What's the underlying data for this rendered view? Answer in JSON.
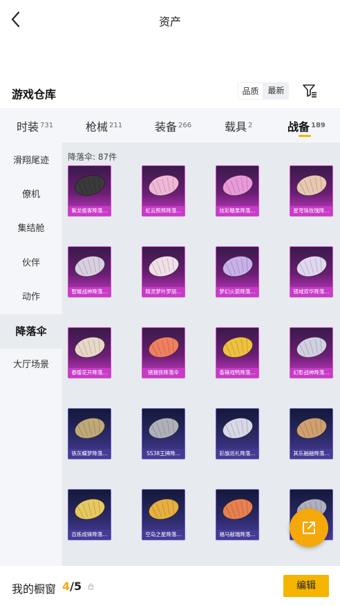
{
  "header": {
    "title": "资产",
    "back_icon": "chevron-left-icon"
  },
  "warehouse": {
    "title": "游戏仓库",
    "sort_options": [
      "品质",
      "最新"
    ],
    "filter_icon": "filter-icon"
  },
  "tabs": [
    {
      "label": "时装",
      "count": "731"
    },
    {
      "label": "枪械",
      "count": "211"
    },
    {
      "label": "装备",
      "count": "266"
    },
    {
      "label": "载具",
      "count": "2"
    },
    {
      "label": "战备",
      "count": "189",
      "active": true
    }
  ],
  "sidebar": [
    {
      "label": "滑翔尾迹"
    },
    {
      "label": "僚机"
    },
    {
      "label": "集结舱"
    },
    {
      "label": "伙伴"
    },
    {
      "label": "动作"
    },
    {
      "label": "降落伞",
      "active": true
    },
    {
      "label": "大厅场景"
    }
  ],
  "content": {
    "title": "降落伞: 87件",
    "items": [
      {
        "name": "紫龙极客降落...",
        "rarity": "purple",
        "color": "#3a3a3a"
      },
      {
        "name": "虹云熊熊降落...",
        "rarity": "purple",
        "color": "#f0b8d8"
      },
      {
        "name": "炫彩糖果降落...",
        "rarity": "purple",
        "color": "#e89ad8"
      },
      {
        "name": "星穹珠玫瑰降...",
        "rarity": "purple",
        "color": "#e8c8b0"
      },
      {
        "name": "智耀战神降落...",
        "rarity": "purple",
        "color": "#d8d0e0"
      },
      {
        "name": "精灵梦叶罗丽...",
        "rarity": "purple",
        "color": "#f0e0e8"
      },
      {
        "name": "梦幻火箭降落...",
        "rarity": "purple",
        "color": "#c8b0e8"
      },
      {
        "name": "镜域双华降落...",
        "rarity": "purple",
        "color": "#e0d8f0"
      },
      {
        "name": "春暖花开降落...",
        "rarity": "purple",
        "color": "#e8d8c8"
      },
      {
        "name": "猪猪侠降落伞",
        "rarity": "purple",
        "color": "#f08060"
      },
      {
        "name": "香辣戏鸭降落...",
        "rarity": "purple",
        "color": "#f0c040"
      },
      {
        "name": "幻影战神降落...",
        "rarity": "purple",
        "color": "#d0d0e0"
      },
      {
        "name": "铁灰蝶梦降落...",
        "rarity": "blue",
        "color": "#c0a878"
      },
      {
        "name": "SS38王牌降...",
        "rarity": "blue",
        "color": "#b0b0b8"
      },
      {
        "name": "彩旗巡礼降落...",
        "rarity": "blue",
        "color": "#d8d8e8"
      },
      {
        "name": "其乐融融降落...",
        "rarity": "blue",
        "color": "#d0a070"
      },
      {
        "name": "百炼成锋降落...",
        "rarity": "blue",
        "color": "#e8c860"
      },
      {
        "name": "空岛之星降落...",
        "rarity": "blue",
        "color": "#e8b040"
      },
      {
        "name": "福马献瑞降落...",
        "rarity": "blue",
        "color": "#e88050"
      },
      {
        "name": "",
        "rarity": "blue",
        "color": "#b0b0c0"
      }
    ]
  },
  "fab_icon": "external-link-icon",
  "bottom": {
    "label": "我的橱窗",
    "count_used": "4",
    "count_sep": "/",
    "count_total": "5",
    "lock_icon": "lock-icon",
    "edit_label": "编辑"
  },
  "colors": {
    "accent": "#f5b400",
    "fab": "#f5a80a"
  }
}
